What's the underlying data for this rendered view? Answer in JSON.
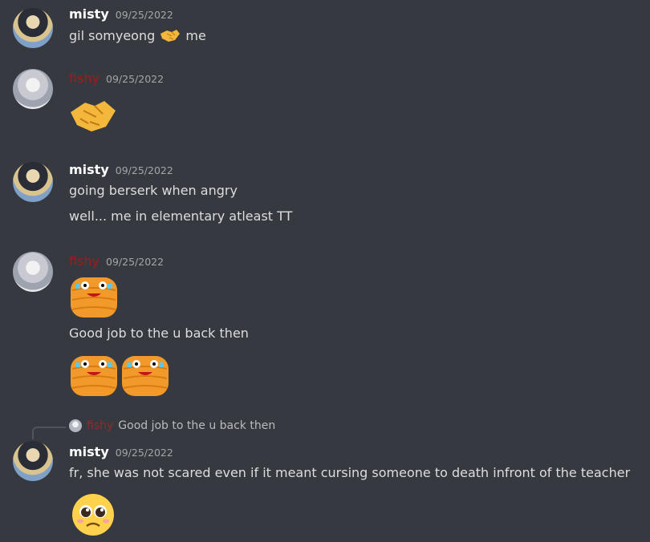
{
  "messages": [
    {
      "user": "misty",
      "time": "09/25/2022",
      "text_before_emoji": "gil somyeong ",
      "text_after_emoji": " me",
      "inline_emoji": "handshake-emoji"
    },
    {
      "user": "fishy",
      "time": "09/25/2022",
      "emoji": "handshake-emoji"
    },
    {
      "user": "misty",
      "time": "09/25/2022",
      "lines": [
        "going berserk when angry",
        "well... me in elementary atleast TT"
      ]
    },
    {
      "user": "fishy",
      "time": "09/25/2022",
      "emoji_top": "crying-bread-emoji",
      "text": "Good job to the u back then",
      "emojis_bottom": [
        "crying-bread-emoji",
        "crying-bread-emoji"
      ]
    },
    {
      "reply": {
        "user": "fishy",
        "text": "Good job to the u back then"
      },
      "user": "misty",
      "time": "09/25/2022",
      "text": "fr, she was not scared even if it meant cursing someone to death infront of the teacher",
      "emoji": "pleading-face-emoji"
    }
  ],
  "colors": {
    "background": "#36393f",
    "username_default": "#ffffff",
    "username_fishy": "#a31a1a",
    "timestamp": "#a3a6aa",
    "message_text": "#dcddde"
  }
}
